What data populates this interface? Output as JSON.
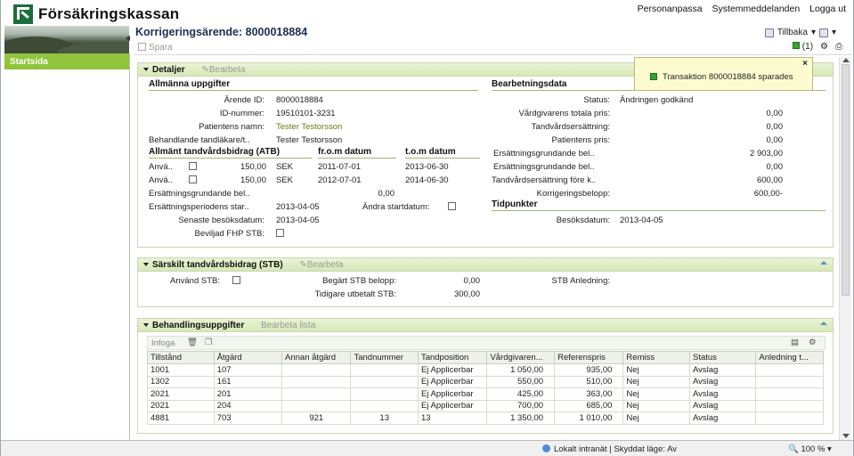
{
  "header": {
    "logo_text": "Försäkringskassan",
    "links": [
      "Personanpassa",
      "Systemmeddelanden",
      "Logga ut"
    ]
  },
  "sidebar": {
    "items": [
      {
        "label": "Startsida"
      }
    ]
  },
  "title": "Korrigeringsärende: 8000018884",
  "tillbaka": "Tillbaka",
  "toolbar": {
    "save_label": "Spara",
    "msg_count": "(1)"
  },
  "toast": {
    "close": "×",
    "message": "Transaktion 8000018884 sparades"
  },
  "detaljer": {
    "title": "Detaljer",
    "edit": "Bearbeta",
    "left_section": "Allmänna uppgifter",
    "right_section": "Bearbetningsdata",
    "fields": [
      {
        "label": "Ärende ID:",
        "value": "8000018884"
      },
      {
        "label": "ID-nummer:",
        "value": "19510101-3231"
      },
      {
        "label": "Patientens namn:",
        "value": "Tester Testorsson"
      },
      {
        "label": "Behandlande tandläkare/t..",
        "value": "Tester Testorsson"
      }
    ],
    "atb_header": [
      "Allmänt tandvårdsbidrag (ATB)",
      "fr.o.m datum",
      "t.o.m datum"
    ],
    "atb_rows": [
      {
        "label": "Anvä..",
        "amount": "150,00",
        "currency": "SEK",
        "from": "2011-07-01",
        "to": "2013-06-30"
      },
      {
        "label": "Anvä..",
        "amount": "150,00",
        "currency": "SEK",
        "from": "2012-07-01",
        "to": "2014-06-30"
      }
    ],
    "ers_grund_label": "Ersättningsgrundande bel..",
    "ers_grund_value": "0,00",
    "ers_period_label": "Ersättningsperiodens star..",
    "ers_period_value": "2013-04-05",
    "andra_label": "Ändra startdatum:",
    "senaste_label": "Senaste besöksdatum:",
    "senaste_value": "2013-04-05",
    "fhp_label": "Beviljad FHP STB:",
    "right_fields": [
      {
        "label": "Status:",
        "value": "Ändringen godkänd"
      },
      {
        "label": "Vårdgivarens totala pris:",
        "value": "0,00"
      },
      {
        "label": "Tandvårdsersättning:",
        "value": "0,00"
      },
      {
        "label": "Patientens pris:",
        "value": "0,00"
      },
      {
        "label": "Ersättningsgrundande bel..",
        "value": "2 903,00"
      },
      {
        "label": "Ersättningsgrundande bel..",
        "value": "0,00"
      },
      {
        "label": "Tandvårdsersättning före k..",
        "value": "600,00"
      },
      {
        "label": "Korrigeringsbelopp:",
        "value": "600,00-"
      }
    ],
    "tidpunkter": "Tidpunkter",
    "besok_label": "Besöksdatum:",
    "besok_value": "2013-04-05"
  },
  "stb": {
    "title": "Särskilt tandvårdsbidrag (STB)",
    "edit": "Bearbeta",
    "anvand_label": "Använd STB:",
    "begart_label": "Begärt STB belopp:",
    "begart_value": "0,00",
    "tidigare_label": "Tidigare utbetalt STB:",
    "tidigare_value": "300,00",
    "anledning_label": "STB Anledning:"
  },
  "behandling": {
    "title": "Behandlingsuppgifter",
    "edit": "Bearbeta lista",
    "infoga": "Infoga",
    "columns": [
      "Tillstånd",
      "Åtgärd",
      "Annan åtgärd",
      "Tandnummer",
      "Tandposition",
      "Vårdgivaren...",
      "Referenspris",
      "Remiss",
      "Status",
      "Anledning t..."
    ],
    "rows": [
      [
        "1001",
        "107",
        "",
        "",
        "Ej Applicerbar",
        "1 050,00",
        "935,00",
        "Nej",
        "Avslag",
        ""
      ],
      [
        "1302",
        "161",
        "",
        "",
        "Ej Applicerbar",
        "550,00",
        "510,00",
        "Nej",
        "Avslag",
        ""
      ],
      [
        "2021",
        "201",
        "",
        "",
        "Ej Applicerbar",
        "425,00",
        "363,00",
        "Nej",
        "Avslag",
        ""
      ],
      [
        "2021",
        "204",
        "",
        "",
        "Ej Applicerbar",
        "700,00",
        "685,00",
        "Nej",
        "Avslag",
        ""
      ],
      [
        "4881",
        "703",
        "921",
        "13",
        "13",
        "1 350,00",
        "1 010,00",
        "Nej",
        "Avslag",
        ""
      ]
    ]
  },
  "statusbar": {
    "zone": "Lokalt intranät | Skyddat läge: Av",
    "zoom": "100 %"
  }
}
